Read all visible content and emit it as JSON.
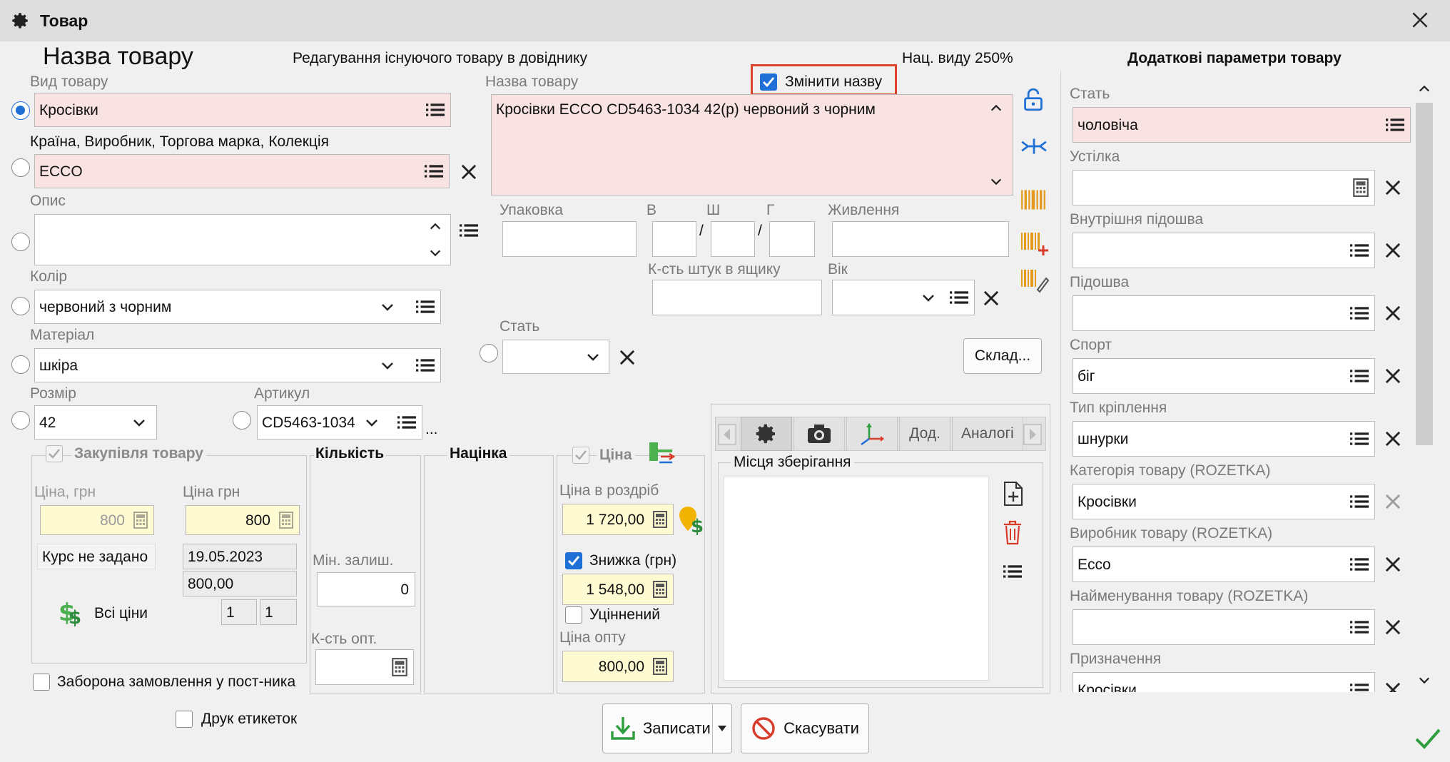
{
  "window": {
    "title": "Товар"
  },
  "header": {
    "product_name_title": "Назва товару",
    "mode_text": "Редагування існуючого товару в довіднику",
    "markup_text": "Нац. виду 250%",
    "rename_label": "Змінити назву",
    "extra_title": "Додаткові параметри товару"
  },
  "left": {
    "kind": {
      "label": "Вид товару",
      "value": "Кросівки"
    },
    "brand": {
      "label": "Країна, Виробник, Торгова марка, Колекція",
      "value": "ECCO"
    },
    "description": {
      "label": "Опис",
      "value": ""
    },
    "color": {
      "label": "Колір",
      "value": "червоний з чорним"
    },
    "material": {
      "label": "Матеріал",
      "value": "шкіра"
    },
    "size": {
      "label": "Розмір",
      "value": "42"
    },
    "article": {
      "label": "Артикул",
      "value": "CD5463-1034",
      "more": "..."
    }
  },
  "middle": {
    "name": {
      "label": "Назва товару",
      "value": "Кросівки ECCO CD5463-1034 42(р) червоний з чорним"
    },
    "package": {
      "label": "Упаковка",
      "value": ""
    },
    "dims": {
      "h_label": "В",
      "w_label": "Ш",
      "d_label": "Г",
      "sep": "/"
    },
    "power": {
      "label": "Живлення",
      "value": ""
    },
    "box_qty": {
      "label": "К-сть штук в ящику",
      "value": ""
    },
    "age": {
      "label": "Вік",
      "value": ""
    },
    "gender": {
      "label": "Стать",
      "value": ""
    },
    "warehouse_button": "Склад..."
  },
  "purchase": {
    "title": "Закупівля товару",
    "price_label": "Ціна, грн",
    "price_value": "800",
    "price2_label": "Ціна грн",
    "price2_value": "800",
    "rate": "Курс не задано",
    "date": "19.05.2023",
    "amount": "800,00",
    "all_prices": "Всі ціни",
    "n1": "1",
    "n2": "1"
  },
  "quantity": {
    "title": "Кількість",
    "min_label": "Мін. залиш.",
    "min_value": "0",
    "wholesale_qty_label": "К-сть опт.",
    "wholesale_qty_value": ""
  },
  "markup": {
    "title": "Націнка"
  },
  "price": {
    "title": "Ціна",
    "retail_label": "Ціна в роздріб",
    "retail_value": "1 720,00",
    "discount_label": "Знижка (грн)",
    "discount_value": "1 548,00",
    "discounted_label": "Уціннений",
    "wholesale_label": "Ціна опту",
    "wholesale_value": "800,00"
  },
  "tabs": {
    "dod": "Дод.",
    "analog": "Аналогі",
    "storage_title": "Місця зберігання"
  },
  "footer": {
    "no_order_label": "Заборона замовлення у пост-ника",
    "print_labels": "Друк етикеток",
    "save_button": "Записати",
    "cancel_button": "Скасувати"
  },
  "extra": {
    "items": [
      {
        "label": "Стать",
        "value": "чоловіча"
      },
      {
        "label": "Устілка",
        "value": ""
      },
      {
        "label": "Внутрішня підошва",
        "value": ""
      },
      {
        "label": "Підошва",
        "value": ""
      },
      {
        "label": "Спорт",
        "value": "біг"
      },
      {
        "label": "Тип кріплення",
        "value": "шнурки"
      },
      {
        "label": "Категорія товару (ROZETKA)",
        "value": "Кросівки"
      },
      {
        "label": "Виробник товару (ROZETKA)",
        "value": "Ecco"
      },
      {
        "label": "Найменування товару (ROZETKA)",
        "value": ""
      },
      {
        "label": "Призначення",
        "value": "Кросівки"
      }
    ]
  },
  "colors": {
    "pink": "#f9e2e2",
    "yellow": "#fefbd2",
    "accent": "#1e6fd6",
    "highlight": "#e0452b",
    "barcode": "#e39a1d"
  }
}
